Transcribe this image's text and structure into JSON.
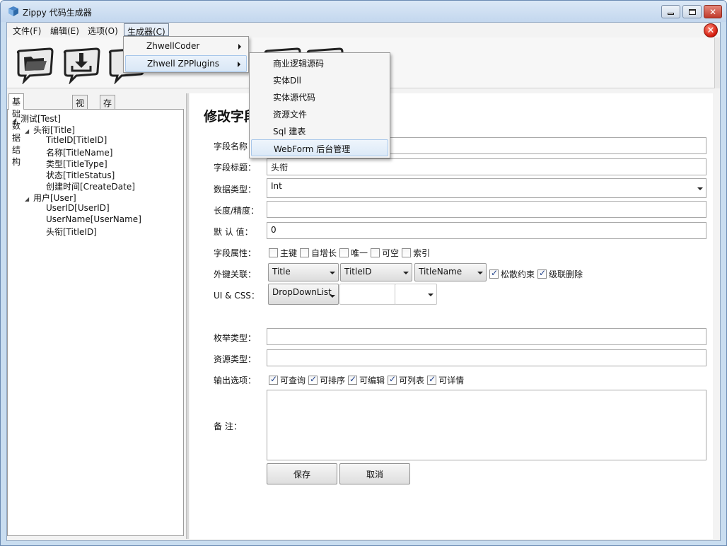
{
  "window": {
    "title": "Zippy 代码生成器"
  },
  "menubar": {
    "items": [
      "文件(F)",
      "编辑(E)",
      "选项(O)",
      "生成器(C)"
    ]
  },
  "generator_menu": {
    "items": [
      {
        "label": "ZhwellCoder",
        "has_submenu": true
      },
      {
        "label": "Zhwell ZPPlugins",
        "has_submenu": true
      }
    ]
  },
  "plugins_submenu": {
    "items": [
      "商业逻辑源码",
      "实体Dll",
      "实体源代码",
      "资源文件",
      "Sql 建表",
      "WebForm 后台管理"
    ]
  },
  "toolbar": {
    "icons": [
      "folder-open-icon",
      "download-icon",
      "toolbar-icon",
      "toolbar-icon",
      "toolbar-icon"
    ]
  },
  "left_panel": {
    "tabs": [
      "基础数据结构",
      "视图",
      "存储过程"
    ],
    "tree": [
      {
        "label": "测试[Test]",
        "level": 0,
        "expanded": true
      },
      {
        "label": "头衔[Title]",
        "level": 1,
        "expanded": true
      },
      {
        "label": "TitleID[TitleID]",
        "level": 2
      },
      {
        "label": "名称[TitleName]",
        "level": 2
      },
      {
        "label": "类型[TitleType]",
        "level": 2
      },
      {
        "label": "状态[TitleStatus]",
        "level": 2
      },
      {
        "label": "创建时间[CreateDate]",
        "level": 2
      },
      {
        "label": "用户[User]",
        "level": 1,
        "expanded": true
      },
      {
        "label": "UserID[UserID]",
        "level": 2
      },
      {
        "label": "UserName[UserName]",
        "level": 2
      },
      {
        "label": "头衔[TitleID]",
        "level": 2
      }
    ]
  },
  "form": {
    "title": "修改字段",
    "field_name_label": "字段名称：",
    "field_name_value": "",
    "field_title_label": "字段标题：",
    "field_title_value": "头衔",
    "data_type_label": "数据类型：",
    "data_type_value": "Int",
    "length_label": "长度/精度：",
    "length_value": "",
    "default_label": "默 认 值：",
    "default_value": "0",
    "attr_label": "字段属性：",
    "attributes": [
      {
        "label": "主键",
        "checked": false
      },
      {
        "label": "自增长",
        "checked": false
      },
      {
        "label": "唯一",
        "checked": false
      },
      {
        "label": "可空",
        "checked": false
      },
      {
        "label": "索引",
        "checked": false
      }
    ],
    "fk_label": "外键关联：",
    "fk_table": "Title",
    "fk_key": "TitleID",
    "fk_display": "TitleName",
    "fk_options": [
      {
        "label": "松散约束",
        "checked": true
      },
      {
        "label": "级联删除",
        "checked": true
      }
    ],
    "ui_label": "UI & CSS：",
    "ui_control": "DropDownList",
    "ui_css": "",
    "enum_label": "枚举类型：",
    "enum_value": "",
    "resource_label": "资源类型：",
    "resource_value": "",
    "output_label": "输出选项：",
    "outputs": [
      {
        "label": "可查询",
        "checked": true
      },
      {
        "label": "可排序",
        "checked": true
      },
      {
        "label": "可编辑",
        "checked": true
      },
      {
        "label": "可列表",
        "checked": true
      },
      {
        "label": "可详情",
        "checked": true
      }
    ],
    "remark_label": "备 注：",
    "save_label": "保存",
    "cancel_label": "取消"
  },
  "colors": {
    "titlebar": "#c9ddf0",
    "close_red": "#d2180a",
    "highlight": "#d9e7f6"
  }
}
